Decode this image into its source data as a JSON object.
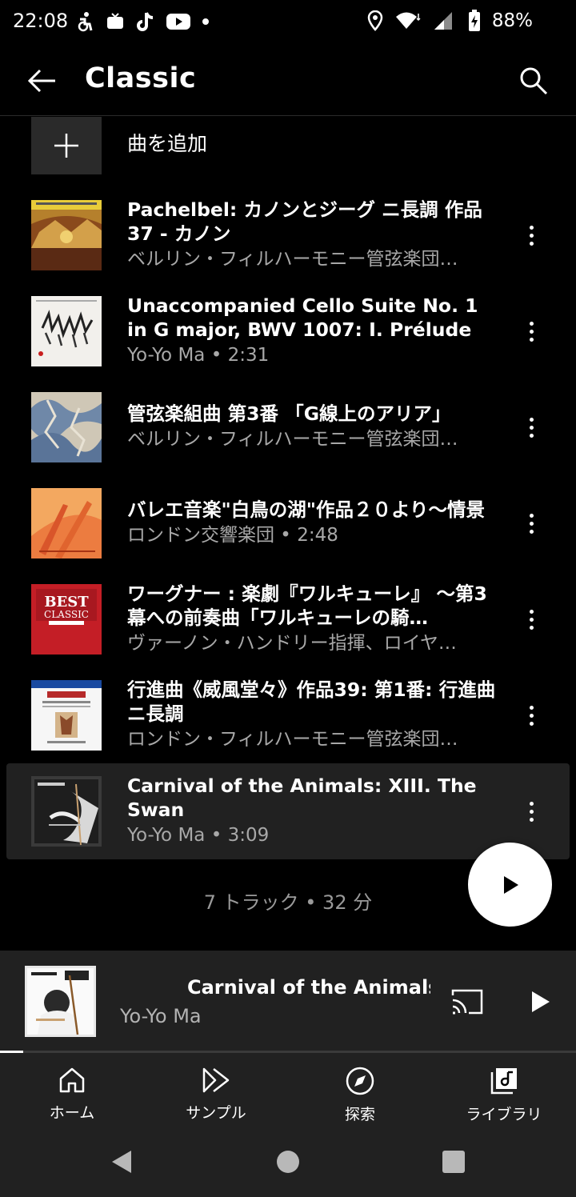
{
  "status_bar": {
    "time": "22:08",
    "battery": "88%",
    "icons": [
      "accessibility-icon",
      "tv-icon",
      "tiktok-icon",
      "youtube-icon",
      "dot-icon",
      "location-icon",
      "wifi-icon",
      "signal-icon",
      "battery-charging-icon"
    ]
  },
  "header": {
    "title": "Classic",
    "back_icon": "arrow-left-icon",
    "search_icon": "search-icon"
  },
  "add_song": {
    "label": "曲を追加",
    "icon": "plus-icon"
  },
  "tracks": [
    {
      "title": "Pachelbel: カノンとジーグ ニ長調 作品37 - カノン",
      "subtitle": "ベルリン・フィルハーモニー管弦楽団…",
      "art_colors": [
        "#c9a23a",
        "#7a3a1a"
      ]
    },
    {
      "title": "Unaccompanied Cello Suite No. 1 in G major, BWV 1007: I. Prélude",
      "subtitle": "Yo-Yo Ma • 2:31",
      "art_colors": [
        "#f2f0ec",
        "#222222"
      ]
    },
    {
      "title": "管弦楽組曲 第3番 「G線上のアリア」",
      "subtitle": "ベルリン・フィルハーモニー管弦楽団…",
      "art_colors": [
        "#8ea2b8",
        "#d8cfc0"
      ]
    },
    {
      "title": "バレエ音楽\"白鳥の湖\"作品２０より〜情景",
      "subtitle": "ロンドン交響楽団 • 2:48",
      "art_colors": [
        "#e8723a",
        "#f4b070"
      ]
    },
    {
      "title": "ワーグナー : 楽劇『ワルキューレ』 ～第3幕への前奏曲「ワルキューレの騎…",
      "subtitle": "ヴァーノン・ハンドリー指揮、ロイヤ…",
      "art_colors": [
        "#c8202a",
        "#ffffff"
      ],
      "art_text": "BEST CLASSIC"
    },
    {
      "title": "行進曲《威風堂々》作品39: 第1番: 行進曲 ニ長調",
      "subtitle": "ロンドン・フィルハーモニー管弦楽団…",
      "art_colors": [
        "#f4f4f4",
        "#1a4aa0"
      ]
    },
    {
      "title": "Carnival of the Animals: XIII. The Swan",
      "subtitle": "Yo-Yo Ma • 3:09",
      "art_colors": [
        "#d8d8d8",
        "#2a2a2a"
      ],
      "active": true
    }
  ],
  "summary": "7 トラック • 32 分",
  "mini_player": {
    "title": "Carnival of the Animals: XIII. The Swan",
    "artist": "Yo-Yo Ma",
    "progress": 0.04
  },
  "bottom_nav": [
    {
      "label": "ホーム",
      "icon": "home-icon"
    },
    {
      "label": "サンプル",
      "icon": "samples-icon"
    },
    {
      "label": "探索",
      "icon": "explore-compass-icon"
    },
    {
      "label": "ライブラリ",
      "icon": "library-icon"
    }
  ]
}
